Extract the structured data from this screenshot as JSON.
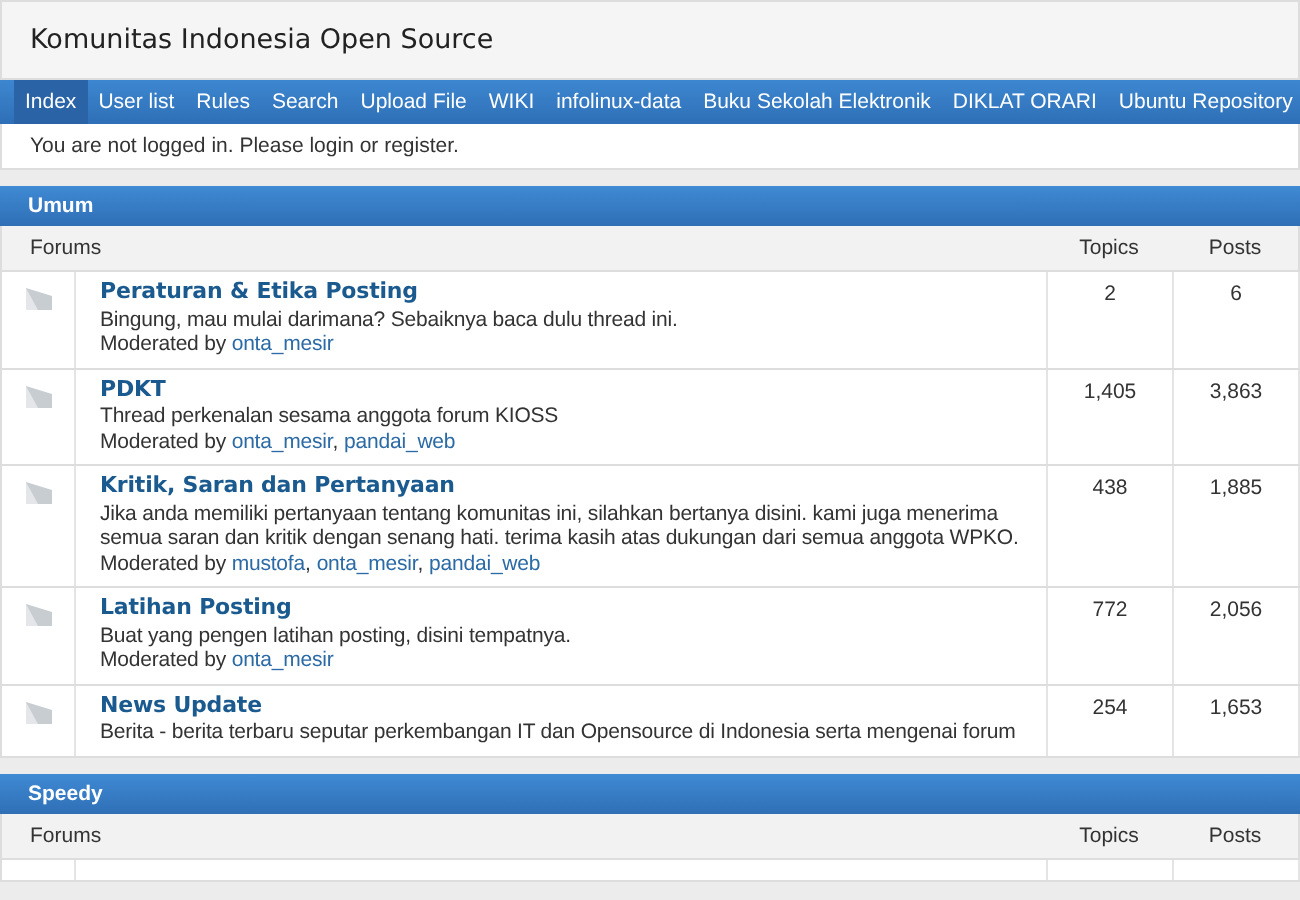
{
  "site_title": "Komunitas Indonesia Open Source",
  "nav": [
    {
      "label": "Index",
      "selected": true
    },
    {
      "label": "User list",
      "selected": false
    },
    {
      "label": "Rules",
      "selected": false
    },
    {
      "label": "Search",
      "selected": false
    },
    {
      "label": "Upload File",
      "selected": false
    },
    {
      "label": "WIKI",
      "selected": false
    },
    {
      "label": "infolinux-data",
      "selected": false
    },
    {
      "label": "Buku Sekolah Elektronik",
      "selected": false
    },
    {
      "label": "DIKLAT ORARI",
      "selected": false
    },
    {
      "label": "Ubuntu Repository",
      "selected": false
    }
  ],
  "login_notice": "You are not logged in. Please login or register.",
  "categories": [
    {
      "title": "Umum",
      "columns": [
        "Forums",
        "Topics",
        "Posts"
      ],
      "moderator_separator": ",",
      "forums": [
        {
          "name": "Peraturan & Etika Posting",
          "description": "Bingung, mau mulai darimana? Sebaiknya baca dulu thread ini.",
          "moderated_label": "Moderated by",
          "moderators": [
            "onta_mesir"
          ],
          "topics": "2",
          "posts": "6"
        },
        {
          "name": "PDKT",
          "description": "Thread perkenalan sesama anggota forum KIOSS",
          "moderated_label": "Moderated by",
          "moderators": [
            "onta_mesir",
            "pandai_web"
          ],
          "topics": "1,405",
          "posts": "3,863"
        },
        {
          "name": "Kritik, Saran dan Pertanyaan",
          "description": "Jika anda memiliki pertanyaan tentang komunitas ini, silahkan bertanya disini. kami juga menerima semua saran dan kritik dengan senang hati. terima kasih atas dukungan dari semua anggota WPKO.",
          "moderated_label": "Moderated by",
          "moderators": [
            "mustofa",
            "onta_mesir",
            "pandai_web"
          ],
          "topics": "438",
          "posts": "1,885"
        },
        {
          "name": "Latihan Posting",
          "description": "Buat yang pengen latihan posting, disini tempatnya.",
          "moderated_label": "Moderated by",
          "moderators": [
            "onta_mesir"
          ],
          "topics": "772",
          "posts": "2,056"
        },
        {
          "name": "News Update",
          "description": "Berita - berita terbaru seputar perkembangan IT dan Opensource di Indonesia serta mengenai forum",
          "topics": "254",
          "posts": "1,653"
        }
      ]
    },
    {
      "title": "Speedy",
      "columns": [
        "Forums",
        "Topics",
        "Posts"
      ]
    }
  ]
}
